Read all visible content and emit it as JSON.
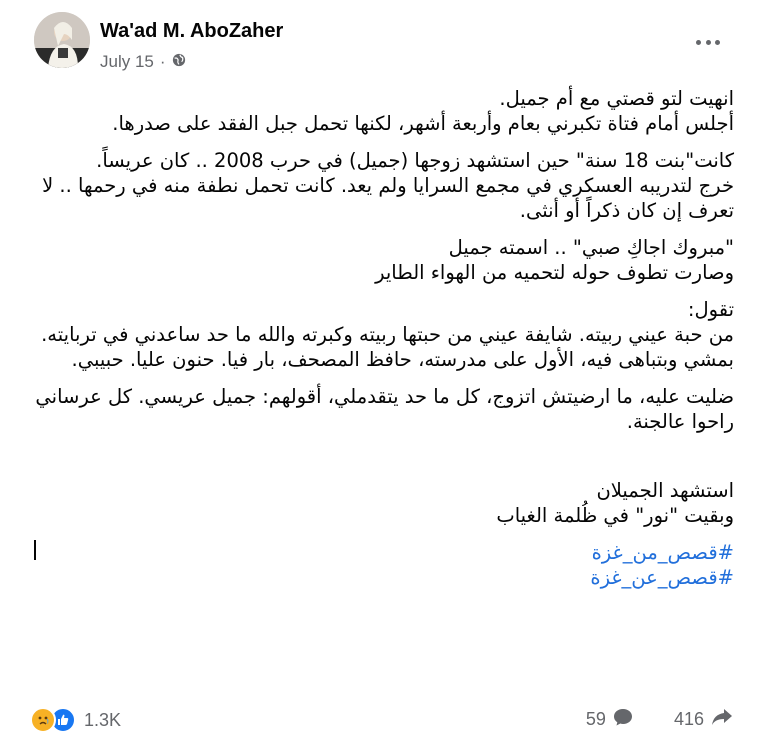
{
  "post": {
    "author": "Wa'ad M. AboZaher",
    "date": "July 15",
    "separator": " · ",
    "privacy_icon": "globe-icon",
    "paragraphs": [
      [
        "انهيت لتو قصتي مع أم جميل.",
        "أجلس أمام فتاة تكبرني بعام وأربعة أشهر، لكنها تحمل جبل الفقد على صدرها."
      ],
      [
        "كانت\"بنت 18 سنة\" حين استشهد زوجها (جميل) في حرب  2008 .. كان عريساً.",
        "خرج لتدريبه العسكري في مجمع السرايا ولم يعد. كانت تحمل نطفة منه في رحمها .. لا تعرف إن كان ذكراً أو أنثى."
      ],
      [
        "\"مبروك اجاكِ صبي\" .. اسمته جميل",
        "وصارت تطوف حوله لتحميه من الهواء الطاير"
      ],
      [
        "تقول:",
        "من حبة عيني ربيته. شايفة عيني من حبتها ربيته وكبرته والله ما حد ساعدني في تربايته. بمشي وبتباهى فيه، الأول على مدرسته، حافظ المصحف، بار فيا. حنون عليا. حبيبي."
      ],
      [
        "ضليت عليه، ما ارضيتش اتزوج، كل ما حد يتقدملي، أقولهم: جميل عريسي. كل عرساني راحوا عالجنة."
      ],
      [
        "استشهد الجميلان",
        "وبقيت \"نور\" في ظُلمة الغياب"
      ]
    ],
    "hashtags": [
      "#قصص_من_غزة",
      "#قصص_عن_غزة"
    ]
  },
  "footer": {
    "reaction_icons": [
      "care-icon",
      "like-icon"
    ],
    "reaction_count": "1.3K",
    "comments_count": "59",
    "shares_count": "416"
  },
  "colors": {
    "hashtag": "#216fdb",
    "secondary_text": "#65676b",
    "like_blue": "#1877f2",
    "care_yellow": "#f7b125"
  }
}
